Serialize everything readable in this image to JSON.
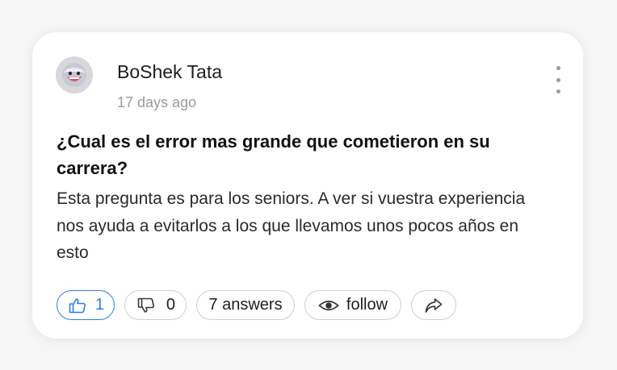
{
  "post": {
    "author": "BoShek Tata",
    "time_ago": "17 days ago",
    "title": "¿Cual es el error mas grande que cometieron en su carrera?",
    "body": "Esta pregunta es para los seniors. A ver si vuestra experiencia nos ayuda a evitarlos a los que llevamos unos pocos años en esto"
  },
  "actions": {
    "likes": "1",
    "dislikes": "0",
    "answers": "7 answers",
    "follow": "follow"
  },
  "icons": {
    "avatar": "avatar-face-icon",
    "menu": "more-vertical-icon",
    "like": "thumbs-up-icon",
    "dislike": "thumbs-down-icon",
    "follow": "eye-icon",
    "share": "share-arrow-icon"
  },
  "colors": {
    "accent": "#2f7ee6",
    "border": "#cfcfcf",
    "muted": "#9a9a9a"
  }
}
